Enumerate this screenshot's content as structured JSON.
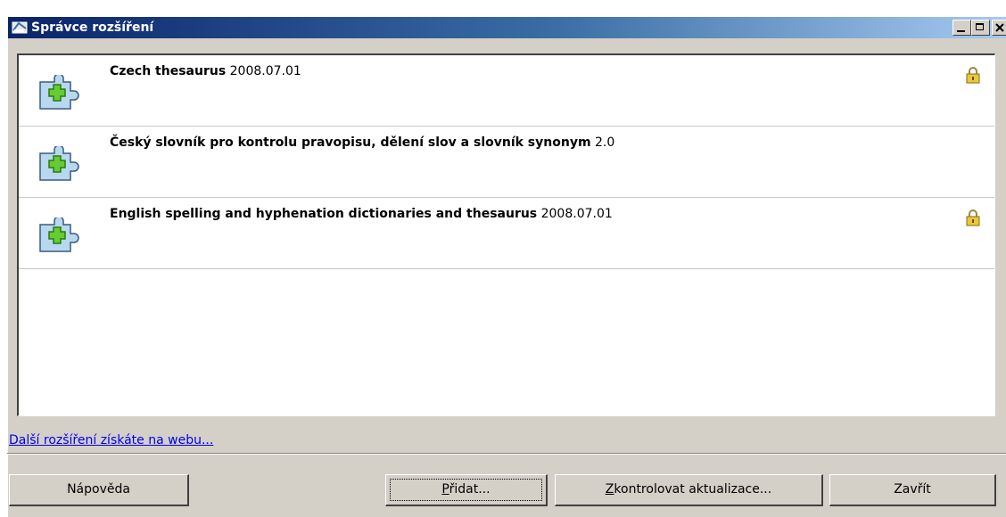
{
  "window": {
    "title": "Správce rozšíření"
  },
  "extensions": [
    {
      "name": "Czech thesaurus",
      "version": "2008.07.01",
      "locked": true,
      "icon": "puzzle-plus-icon"
    },
    {
      "name": "Český slovník pro kontrolu pravopisu, dělení slov a slovník synonym",
      "version": "2.0",
      "locked": false,
      "icon": "puzzle-plus-icon"
    },
    {
      "name": "English spelling and hyphenation dictionaries and thesaurus",
      "version": "2008.07.01",
      "locked": true,
      "icon": "puzzle-plus-icon"
    }
  ],
  "link": {
    "text": "Další rozšíření získáte na webu..."
  },
  "buttons": {
    "help": "Nápověda",
    "add_mnemonic": "P",
    "add_rest": "řidat...",
    "check_mnemonic": "Z",
    "check_rest": "kontrolovat aktualizace...",
    "close": "Zavřít"
  },
  "colors": {
    "titlebar_start": "#0a246a",
    "titlebar_end": "#a6caf0",
    "face": "#d4d0c8",
    "link": "#0000ee"
  }
}
